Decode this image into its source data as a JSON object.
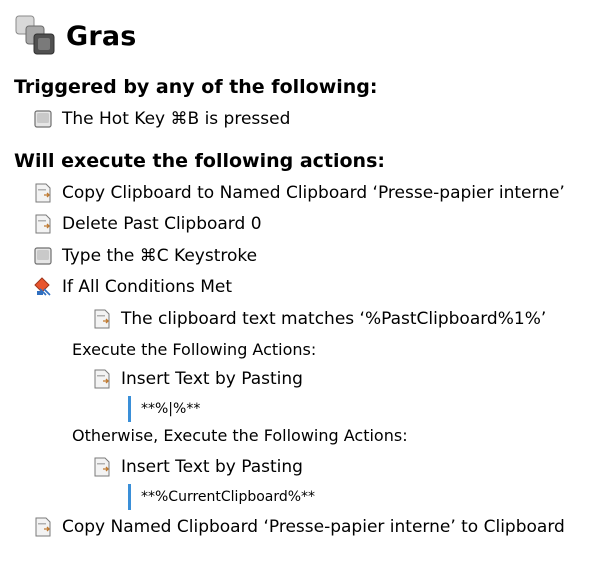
{
  "macro": {
    "title": "Gras",
    "icon": "macro-group-icon"
  },
  "trigger_section": {
    "heading": "Triggered by any of the following:",
    "items": [
      {
        "text": "The Hot Key ⌘B is pressed",
        "icon": "hotkey-icon"
      }
    ]
  },
  "actions_section": {
    "heading": "Will execute the following actions:",
    "actions": [
      {
        "text": "Copy Clipboard to Named Clipboard ‘Presse-papier interne’",
        "icon": "clipboard-action-icon"
      },
      {
        "text": "Delete Past Clipboard 0",
        "icon": "clipboard-action-icon"
      },
      {
        "text": "Type the ⌘C Keystroke",
        "icon": "keystroke-icon"
      },
      {
        "text": "If All Conditions Met",
        "icon": "if-condition-icon"
      }
    ],
    "condition": {
      "text": "The clipboard text matches ‘%PastClipboard%1%’",
      "icon": "clipboard-action-icon"
    },
    "then_label": "Execute the Following Actions:",
    "then_action": {
      "text": "Insert Text by Pasting",
      "icon": "clipboard-action-icon",
      "code": "**%|%**"
    },
    "else_label": "Otherwise, Execute the Following Actions:",
    "else_action": {
      "text": "Insert Text by Pasting",
      "icon": "clipboard-action-icon",
      "code": "**%CurrentClipboard%**"
    },
    "final_action": {
      "text": "Copy Named Clipboard ‘Presse-papier interne’ to Clipboard",
      "icon": "clipboard-action-icon"
    }
  }
}
